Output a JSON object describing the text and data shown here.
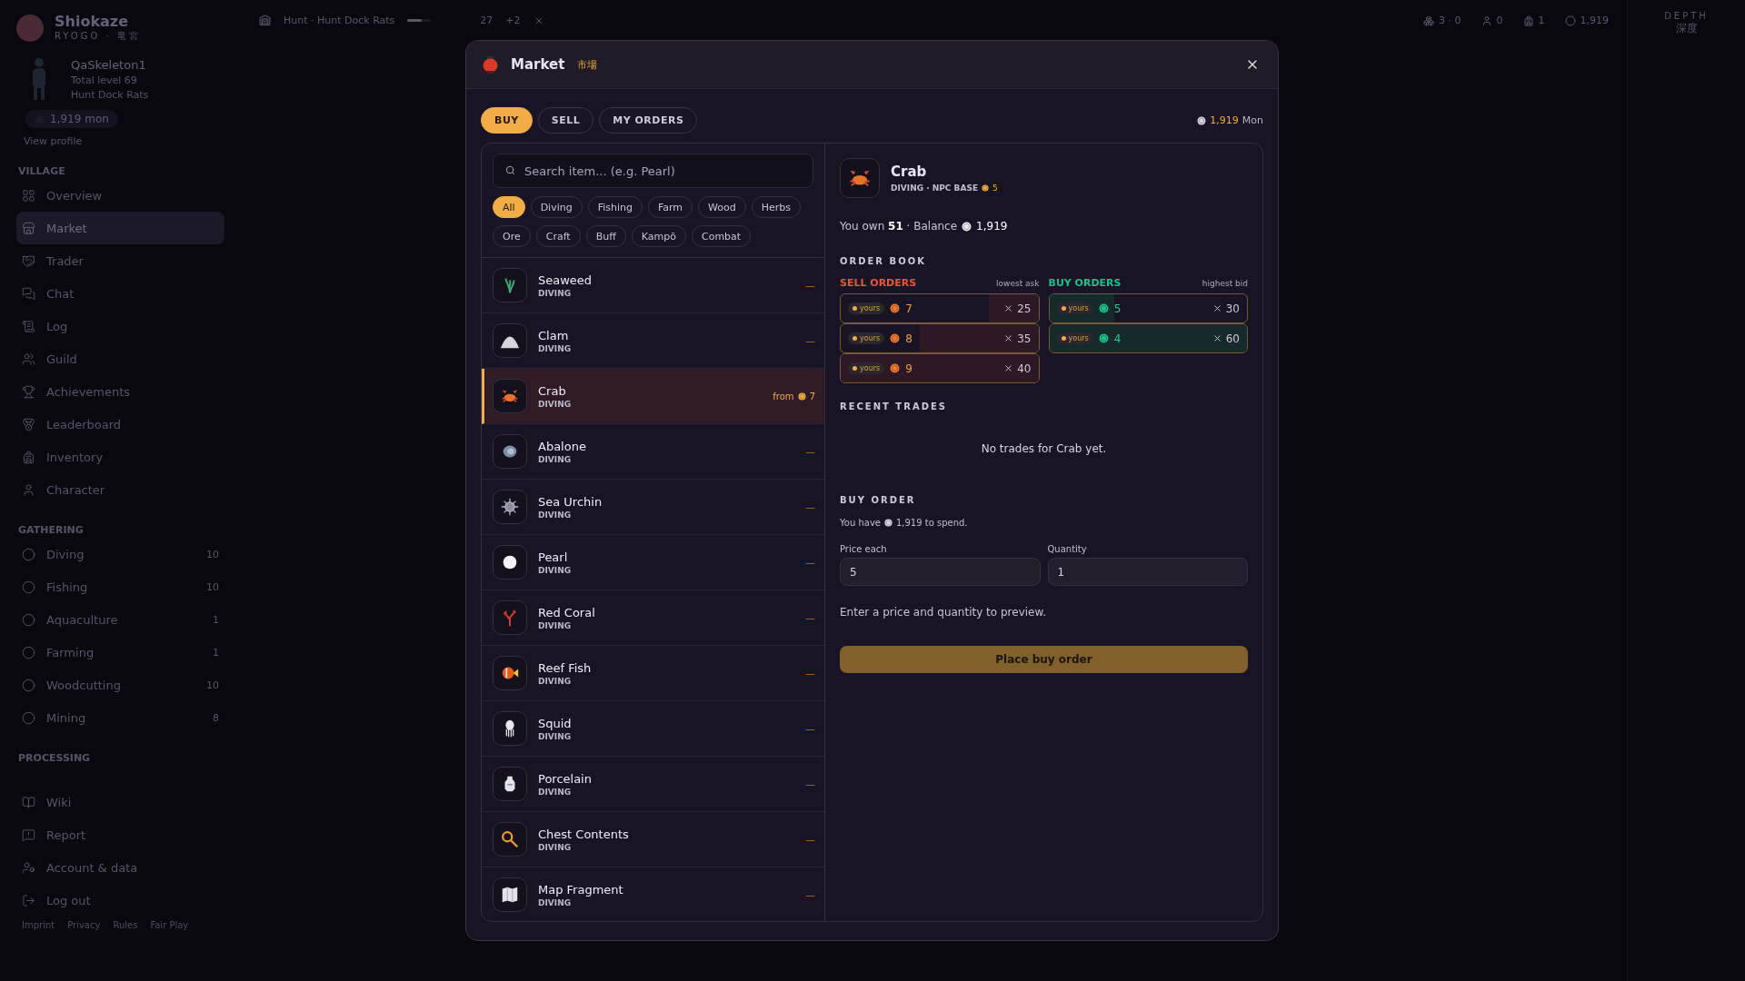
{
  "app": {
    "brand": {
      "name": "Shiokaze",
      "sub": "RYOGO · 竜宮"
    },
    "profile": {
      "name": "QaSkeleton1",
      "level": "Total level 69",
      "activity": "Hunt Dock Rats",
      "coins": "1,919",
      "coin_unit": "mon",
      "link": "View profile"
    },
    "sections": [
      {
        "title": "VILLAGE",
        "items": [
          {
            "label": "Overview",
            "selected": false
          },
          {
            "label": "Market",
            "selected": true
          },
          {
            "label": "Trader",
            "selected": false
          },
          {
            "label": "Chat",
            "selected": false
          },
          {
            "label": "Log",
            "selected": false
          },
          {
            "label": "Guild",
            "selected": false
          },
          {
            "label": "Achievements",
            "selected": false
          },
          {
            "label": "Leaderboard",
            "selected": false
          },
          {
            "label": "Inventory",
            "selected": false
          },
          {
            "label": "Character",
            "selected": false
          }
        ]
      },
      {
        "title": "GATHERING",
        "items": [
          {
            "label": "Diving",
            "count": "10",
            "selected": false
          },
          {
            "label": "Fishing",
            "count": "10",
            "selected": false
          },
          {
            "label": "Aquaculture",
            "count": "1",
            "selected": false
          },
          {
            "label": "Farming",
            "count": "1",
            "selected": false
          },
          {
            "label": "Woodcutting",
            "count": "10",
            "selected": false
          },
          {
            "label": "Mining",
            "count": "8",
            "selected": false
          }
        ]
      },
      {
        "title": "PROCESSING"
      }
    ],
    "footer_items": [
      "Wiki",
      "Report",
      "Account & data",
      "Log out"
    ],
    "legal": [
      "Imprint",
      "Privacy",
      "Rules",
      "Fair Play"
    ],
    "topbar": {
      "task": "Hunt · Hunt Dock Rats",
      "level": 0.6,
      "count": "27",
      "extra": "+2"
    },
    "stats": [
      "3 · 0",
      "0",
      "1",
      "1,919"
    ],
    "depth": {
      "label": "DEPTH",
      "kanji": "深度"
    }
  },
  "market": {
    "title": "Market",
    "kanji": "市場",
    "tabs": [
      {
        "label": "BUY",
        "selected": true
      },
      {
        "label": "SELL",
        "selected": false
      },
      {
        "label": "MY ORDERS",
        "selected": false
      }
    ],
    "balance": {
      "value": "1,919",
      "unit": "Mon"
    },
    "search": {
      "placeholder": "Search item... (e.g. Pearl)"
    },
    "filters": [
      {
        "label": "All",
        "selected": true
      },
      {
        "label": "Diving",
        "selected": false
      },
      {
        "label": "Fishing",
        "selected": false
      },
      {
        "label": "Farm",
        "selected": false
      },
      {
        "label": "Wood",
        "selected": false
      },
      {
        "label": "Herbs",
        "selected": false
      },
      {
        "label": "Ore",
        "selected": false
      },
      {
        "label": "Craft",
        "selected": false
      },
      {
        "label": "Buff",
        "selected": false
      },
      {
        "label": "Kampō",
        "selected": false
      },
      {
        "label": "Combat",
        "selected": false
      }
    ],
    "items": [
      {
        "name": "Seaweed",
        "category": "DIVING",
        "selected": false,
        "kind": "none",
        "price": "—"
      },
      {
        "name": "Clam",
        "category": "DIVING",
        "selected": false,
        "kind": "none",
        "price": "—"
      },
      {
        "name": "Crab",
        "category": "DIVING",
        "selected": true,
        "kind": "listed",
        "from": "from",
        "price": "7"
      },
      {
        "name": "Abalone",
        "category": "DIVING",
        "selected": false,
        "kind": "none",
        "price": "—"
      },
      {
        "name": "Sea Urchin",
        "category": "DIVING",
        "selected": false,
        "kind": "none",
        "price": "—"
      },
      {
        "name": "Pearl",
        "category": "DIVING",
        "selected": false,
        "kind": "none",
        "price": "—"
      },
      {
        "name": "Red Coral",
        "category": "DIVING",
        "selected": false,
        "kind": "none",
        "price": "—"
      },
      {
        "name": "Reef Fish",
        "category": "DIVING",
        "selected": false,
        "kind": "none",
        "price": "—"
      },
      {
        "name": "Squid",
        "category": "DIVING",
        "selected": false,
        "kind": "none",
        "price": "—"
      },
      {
        "name": "Porcelain",
        "category": "DIVING",
        "selected": false,
        "kind": "none",
        "price": "—"
      },
      {
        "name": "Chest Contents",
        "category": "DIVING",
        "selected": false,
        "kind": "none",
        "price": "—"
      },
      {
        "name": "Map Fragment",
        "category": "DIVING",
        "selected": false,
        "kind": "none",
        "price": "—"
      }
    ],
    "detail": {
      "name": "Crab",
      "meta": "DIVING · NPC BASE",
      "base": "5",
      "own": "You own **51** · Balance",
      "balance": "1,919",
      "order_book": "ORDER BOOK",
      "sell": {
        "title": "SELL ORDERS",
        "hint": "lowest ask",
        "rows": [
          {
            "badge": "yours",
            "price": "7",
            "qty": "25",
            "level": 0.25
          },
          {
            "badge": "yours",
            "price": "8",
            "qty": "35",
            "level": 0.6
          },
          {
            "badge": "yours",
            "price": "9",
            "qty": "40",
            "level": 1
          }
        ]
      },
      "buy": {
        "title": "BUY ORDERS",
        "hint": "highest bid",
        "rows": [
          {
            "badge": "yours",
            "price": "5",
            "qty": "30",
            "level": 0.33
          },
          {
            "badge": "yours",
            "price": "4",
            "qty": "60",
            "level": 1
          }
        ]
      },
      "recent": "RECENT TRADES",
      "empty": "No trades for Crab yet.",
      "buy_order": {
        "title": "BUY ORDER",
        "have_prefix": "You have",
        "have_suffix": "1,919 to spend.",
        "fields": [
          {
            "label": "Price each",
            "value": "5"
          },
          {
            "label": "Quantity",
            "value": "1"
          }
        ],
        "hint": "Enter a price and quantity to preview.",
        "button": "Place buy order"
      }
    }
  }
}
